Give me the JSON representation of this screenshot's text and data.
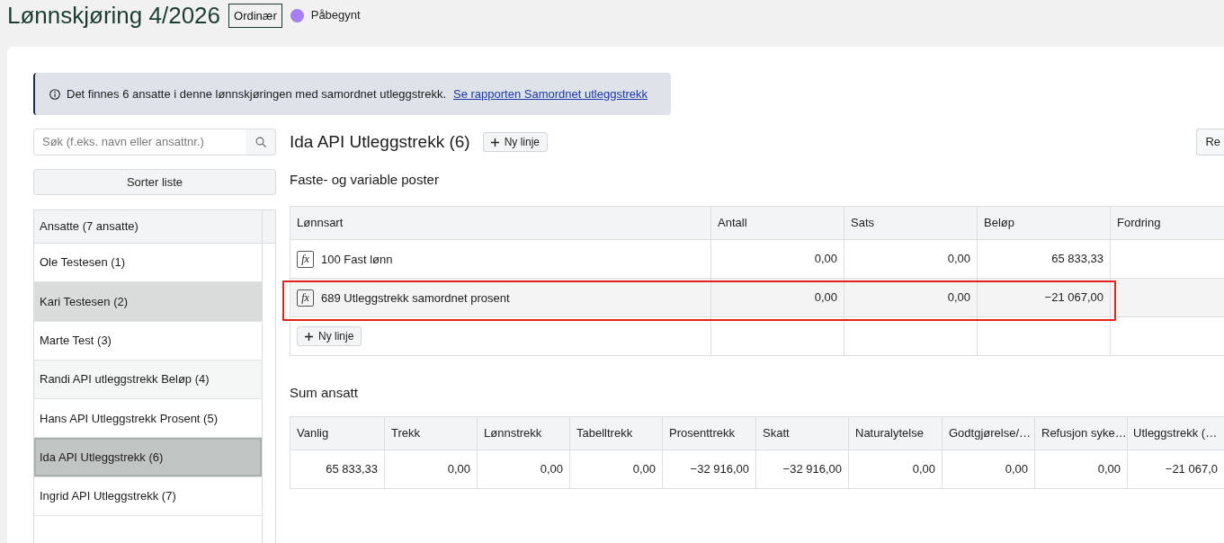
{
  "header": {
    "title": "Lønnskjøring 4/2026",
    "type_tag": "Ordinær",
    "status": {
      "label": "Påbegynt",
      "color": "#a57ef2"
    }
  },
  "alert": {
    "text": "Det finnes 6 ansatte i denne lønnskjøringen med samordnet utleggstrekk.",
    "link": "Se rapporten Samordnet utleggstrekk"
  },
  "sidebar": {
    "search": {
      "placeholder": "Søk (f.eks. navn eller ansattnr.)"
    },
    "sort_button": "Sorter liste",
    "list_header": "Ansatte (7 ansatte)",
    "employees": [
      {
        "name": "Ole Testesen (1)",
        "selected": false,
        "highlighted": false
      },
      {
        "name": "Kari Testesen (2)",
        "selected": false,
        "highlighted": true
      },
      {
        "name": "Marte Test (3)",
        "selected": false,
        "highlighted": false
      },
      {
        "name": "Randi API utleggstrekk Beløp (4)",
        "selected": false,
        "highlighted": false
      },
      {
        "name": "Hans API Utleggstrekk Prosent (5)",
        "selected": false,
        "highlighted": false
      },
      {
        "name": "Ida API Utleggstrekk (6)",
        "selected": true,
        "highlighted": false
      },
      {
        "name": "Ingrid API Utleggstrekk (7)",
        "selected": false,
        "highlighted": false
      }
    ]
  },
  "employee": {
    "title": "Ida API Utleggstrekk (6)",
    "add_line_button": "Ny linje",
    "right_button": "Re",
    "section_title": "Faste- og variable poster",
    "items_table": {
      "columns": [
        "Lønnsart",
        "Antall",
        "Sats",
        "Beløp",
        "Fordring"
      ],
      "rows": [
        {
          "marker": "fx",
          "cells": [
            "100 Fast lønn",
            "0,00",
            "0,00",
            "65 833,33"
          ],
          "outlined": false
        },
        {
          "marker": "fx",
          "cells": [
            "689 Utleggstrekk samordnet prosent",
            "0,00",
            "0,00",
            "−21 067,00"
          ],
          "outlined": true
        }
      ],
      "add_line_button": "Ny linje"
    },
    "sum_title": "Sum ansatt",
    "sum_table": {
      "columns": [
        "Vanlig",
        "Trekk",
        "Lønnstrekk",
        "Tabelltrekk",
        "Prosenttrekk",
        "Skatt",
        "Naturalytelse",
        "Godtgjørelse/…",
        "Refusjon syke…",
        "Utleggstrekk (…"
      ],
      "rows": [
        [
          "65 833,33",
          "0,00",
          "0,00",
          "0,00",
          "−32 916,00",
          "−32 916,00",
          "0,00",
          "0,00",
          "0,00",
          "−21 067,0"
        ]
      ]
    }
  }
}
